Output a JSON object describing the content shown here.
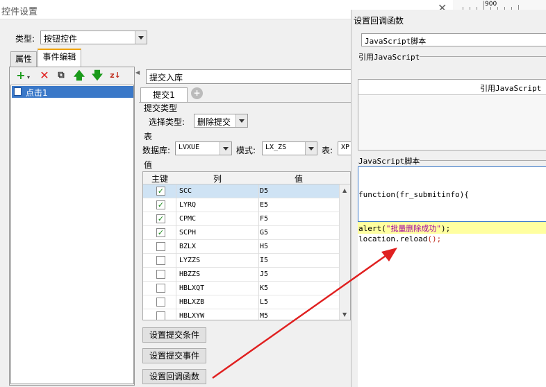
{
  "main_window": {
    "title": "控件设置",
    "close": "✕",
    "type_label": "类型:",
    "type_value": "按钮控件",
    "tabs": [
      "属性",
      "事件编辑"
    ],
    "event_tree_item": "点击1",
    "event_name": "提交入库",
    "submit_tab": "提交1",
    "submit_type_section": "提交类型",
    "select_type_label": "选择类型:",
    "select_type_value": "删除提交",
    "table_section": "表",
    "db_label": "数据库:",
    "db_value": "LVXUE",
    "schema_label": "模式:",
    "schema_value": "LX_ZS",
    "table_label": "表:",
    "table_value": "XP",
    "value_section": "值",
    "grid_headers": [
      "主键",
      "列",
      "值"
    ],
    "rows": [
      {
        "key": true,
        "col": "SCC",
        "val": "D5",
        "selected": true
      },
      {
        "key": true,
        "col": "LYRQ",
        "val": "E5"
      },
      {
        "key": true,
        "col": "CPMC",
        "val": "F5"
      },
      {
        "key": true,
        "col": "SCPH",
        "val": "G5"
      },
      {
        "key": false,
        "col": "BZLX",
        "val": "H5"
      },
      {
        "key": false,
        "col": "LYZZS",
        "val": "I5"
      },
      {
        "key": false,
        "col": "HBZZS",
        "val": "J5"
      },
      {
        "key": false,
        "col": "HBLXQT",
        "val": "K5"
      },
      {
        "key": false,
        "col": "HBLXZB",
        "val": "L5"
      },
      {
        "key": false,
        "col": "HBLXYW",
        "val": "M5"
      }
    ],
    "buttons": [
      "设置提交条件",
      "设置提交事件",
      "设置回调函数"
    ]
  },
  "ruler": {
    "label": "900"
  },
  "callback_dialog": {
    "title": "设置回调函数",
    "type_value": "JavaScript脚本",
    "ref_section": "引用JavaScript",
    "ref_header": "引用JavaScript",
    "script_section": "JavaScript脚本",
    "func_header": "function(fr_submitinfo){",
    "code_line1": "alert(\"批量删除成功\");",
    "code_line2": "location.reload();"
  },
  "colors": {
    "arrow": "#e02020",
    "highlight": "#ffffa0",
    "selection": "#cfe3f4",
    "tab_accent": "#f0a30a"
  }
}
